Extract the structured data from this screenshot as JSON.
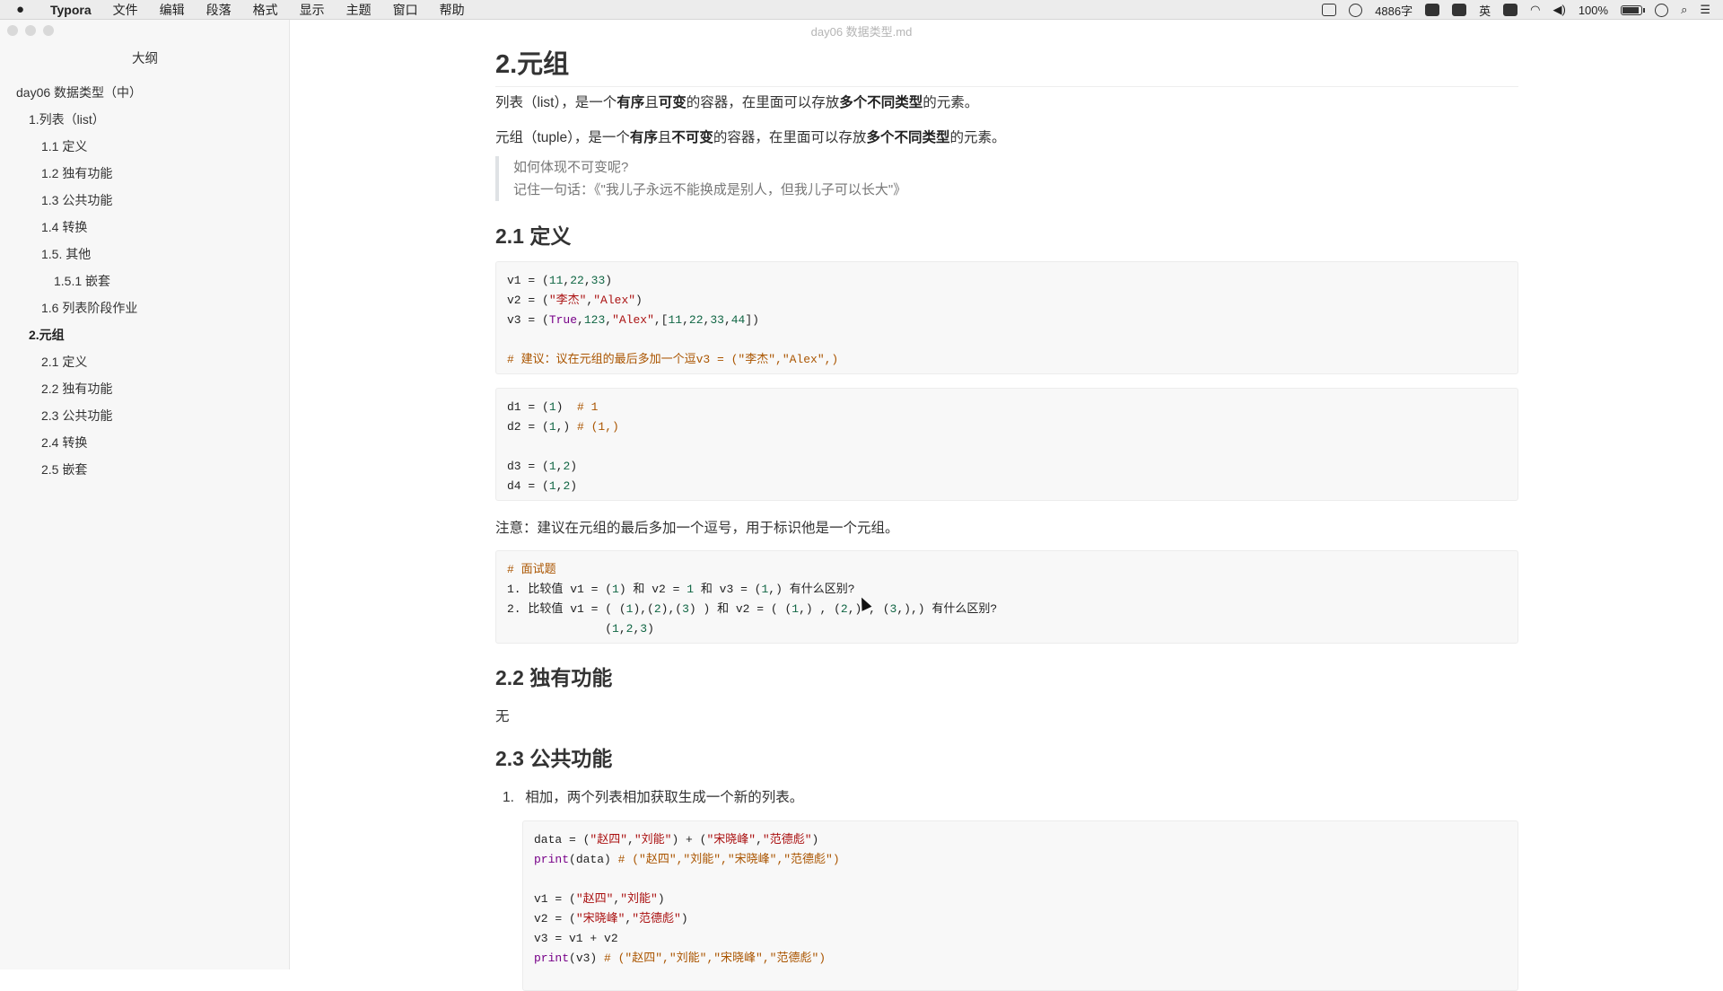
{
  "menubar": {
    "app": "Typora",
    "items": [
      "文件",
      "编辑",
      "段落",
      "格式",
      "显示",
      "主题",
      "窗口",
      "帮助"
    ],
    "word_count": "4886字",
    "ime": "英",
    "battery": "100%"
  },
  "window": {
    "title": "day06 数据类型.md"
  },
  "sidebar": {
    "title": "大纲",
    "items": [
      {
        "label": "day06 数据类型（中）",
        "level": 0
      },
      {
        "label": "1.列表（list）",
        "level": 1
      },
      {
        "label": "1.1 定义",
        "level": 2
      },
      {
        "label": "1.2 独有功能",
        "level": 2
      },
      {
        "label": "1.3 公共功能",
        "level": 2
      },
      {
        "label": "1.4 转换",
        "level": 2
      },
      {
        "label": "1.5. 其他",
        "level": 2
      },
      {
        "label": "1.5.1 嵌套",
        "level": 3
      },
      {
        "label": "1.6 列表阶段作业",
        "level": 2
      },
      {
        "label": "2.元组",
        "level": 1,
        "active": true
      },
      {
        "label": "2.1 定义",
        "level": 2
      },
      {
        "label": "2.2 独有功能",
        "level": 2
      },
      {
        "label": "2.3 公共功能",
        "level": 2
      },
      {
        "label": "2.4 转换",
        "level": 2
      },
      {
        "label": "2.5 嵌套",
        "level": 2
      }
    ]
  },
  "doc": {
    "h_tuple": "2.元组",
    "p_list": {
      "a": "列表（list），是一个",
      "b1": "有序",
      "c": "且",
      "b2": "可变",
      "d": "的容器，在里面可以存放",
      "b3": "多个不同类型",
      "e": "的元素。"
    },
    "p_tuple": {
      "a": "元组（tuple），是一个",
      "b1": "有序",
      "c": "且",
      "b2": "不可变",
      "d": "的容器，在里面可以存放",
      "b3": "多个不同类型",
      "e": "的元素。"
    },
    "quote": [
      "如何体现不可变呢?",
      "记住一句话：《\"我儿子永远不能换成是别人，但我儿子可以长大\"》"
    ],
    "h_def": "2.1 定义",
    "code1": [
      [
        [
          "v1 = (",
          ""
        ],
        [
          "11",
          "num"
        ],
        [
          ",",
          ""
        ],
        [
          "22",
          "num"
        ],
        [
          ",",
          ""
        ],
        [
          "33",
          "num"
        ],
        [
          ")",
          ""
        ]
      ],
      [
        [
          "v2 = (",
          ""
        ],
        [
          "\"李杰\"",
          "str"
        ],
        [
          ",",
          ""
        ],
        [
          "\"Alex\"",
          "str"
        ],
        [
          ")",
          ""
        ]
      ],
      [
        [
          "v3 = (",
          ""
        ],
        [
          "True",
          "kw"
        ],
        [
          ",",
          ""
        ],
        [
          "123",
          "num"
        ],
        [
          ",",
          ""
        ],
        [
          "\"Alex\"",
          "str"
        ],
        [
          ",[",
          ""
        ],
        [
          "11",
          "num"
        ],
        [
          ",",
          ""
        ],
        [
          "22",
          "num"
        ],
        [
          ",",
          ""
        ],
        [
          "33",
          "num"
        ],
        [
          ",",
          ""
        ],
        [
          "44",
          "num"
        ],
        [
          "])",
          ""
        ]
      ],
      [],
      [
        [
          "# 建议：议在元组的最后多加一个逗v3 = (\"李杰\",\"Alex\",)",
          "cm"
        ]
      ]
    ],
    "code2": [
      [
        [
          "d1 = (",
          ""
        ],
        [
          "1",
          "num"
        ],
        [
          ")  ",
          ""
        ],
        [
          "# 1",
          "cm"
        ]
      ],
      [
        [
          "d2 = (",
          ""
        ],
        [
          "1",
          "num"
        ],
        [
          ",) ",
          ""
        ],
        [
          "# (1,)",
          "cm"
        ]
      ],
      [],
      [
        [
          "d3 = (",
          ""
        ],
        [
          "1",
          "num"
        ],
        [
          ",",
          ""
        ],
        [
          "2",
          "num"
        ],
        [
          ")",
          ""
        ]
      ],
      [
        [
          "d4 = (",
          ""
        ],
        [
          "1",
          "num"
        ],
        [
          ",",
          ""
        ],
        [
          "2",
          "num"
        ],
        [
          ")",
          ""
        ]
      ]
    ],
    "note": "注意：建议在元组的最后多加一个逗号，用于标识他是一个元组。",
    "code3": [
      [
        [
          "# 面试题",
          "cm"
        ]
      ],
      [
        [
          "1. ",
          ""
        ],
        [
          "比较值 v1 = (",
          ""
        ],
        [
          "1",
          "num"
        ],
        [
          ") 和 v2 = ",
          ""
        ],
        [
          "1",
          "num"
        ],
        [
          " 和 v3 = (",
          ""
        ],
        [
          "1",
          "num"
        ],
        [
          ",) 有什么区别?",
          ""
        ]
      ],
      [
        [
          "2. ",
          ""
        ],
        [
          "比较值 v1 = ( (",
          ""
        ],
        [
          "1",
          "num"
        ],
        [
          "),(",
          ""
        ],
        [
          "2",
          "num"
        ],
        [
          "),(",
          ""
        ],
        [
          "3",
          "num"
        ],
        [
          ") ) 和 v2 = ( (",
          ""
        ],
        [
          "1",
          "num"
        ],
        [
          ",) , (",
          ""
        ],
        [
          "2",
          "num"
        ],
        [
          ",) , (",
          ""
        ],
        [
          "3",
          "num"
        ],
        [
          ",),) 有什么区别?",
          ""
        ]
      ],
      [
        [
          "              (",
          ""
        ],
        [
          "1",
          "num"
        ],
        [
          ",",
          ""
        ],
        [
          "2",
          "num"
        ],
        [
          ",",
          ""
        ],
        [
          "3",
          "num"
        ],
        [
          ")",
          ""
        ]
      ]
    ],
    "h_unique": "2.2 独有功能",
    "none": "无",
    "h_public": "2.3 公共功能",
    "li1_num": "1.",
    "li1": "相加，两个列表相加获取生成一个新的列表。",
    "code4": [
      [
        [
          "data = (",
          ""
        ],
        [
          "\"赵四\"",
          "str"
        ],
        [
          ",",
          ""
        ],
        [
          "\"刘能\"",
          "str"
        ],
        [
          ") + (",
          ""
        ],
        [
          "\"宋晓峰\"",
          "str"
        ],
        [
          ",",
          ""
        ],
        [
          "\"范德彪\"",
          "str"
        ],
        [
          ")",
          ""
        ]
      ],
      [
        [
          "print",
          "kw"
        ],
        [
          "(data) ",
          ""
        ],
        [
          "# (\"赵四\",\"刘能\",\"宋晓峰\",\"范德彪\")",
          "cm"
        ]
      ],
      [],
      [
        [
          "v1 = (",
          ""
        ],
        [
          "\"赵四\"",
          "str"
        ],
        [
          ",",
          ""
        ],
        [
          "\"刘能\"",
          "str"
        ],
        [
          ")",
          ""
        ]
      ],
      [
        [
          "v2 = (",
          ""
        ],
        [
          "\"宋晓峰\"",
          "str"
        ],
        [
          ",",
          ""
        ],
        [
          "\"范德彪\"",
          "str"
        ],
        [
          ")",
          ""
        ]
      ],
      [
        [
          "v3 = v1 + v2",
          ""
        ]
      ],
      [
        [
          "print",
          "kw"
        ],
        [
          "(v3) ",
          ""
        ],
        [
          "# (\"赵四\",\"刘能\",\"宋晓峰\",\"范德彪\")",
          "cm"
        ]
      ]
    ]
  }
}
